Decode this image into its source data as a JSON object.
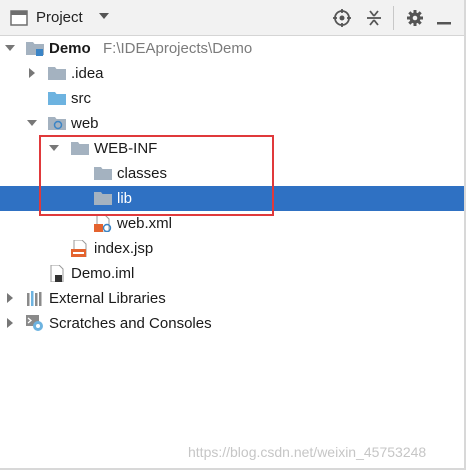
{
  "header": {
    "title": "Project",
    "buttons": [
      "locate-icon",
      "collapse-icon",
      "gear-icon",
      "hide-icon"
    ]
  },
  "tree": {
    "root": {
      "name": "Demo",
      "path": "F:\\IDEAprojects\\Demo"
    },
    "idea": ".idea",
    "src": "src",
    "web": "web",
    "web_inf": "WEB-INF",
    "classes": "classes",
    "lib": "lib",
    "web_xml": "web.xml",
    "index_jsp": "index.jsp",
    "demo_iml": "Demo.iml",
    "external_libraries": "External Libraries",
    "scratches": "Scratches and Consoles"
  },
  "selected_item": "lib",
  "colors": {
    "selection": "#2f71c3",
    "folder": "#a4b2c0",
    "source_folder": "#6db3e0",
    "annotation": "#e0393b"
  },
  "watermark": "https://blog.csdn.net/weixin_45753248"
}
